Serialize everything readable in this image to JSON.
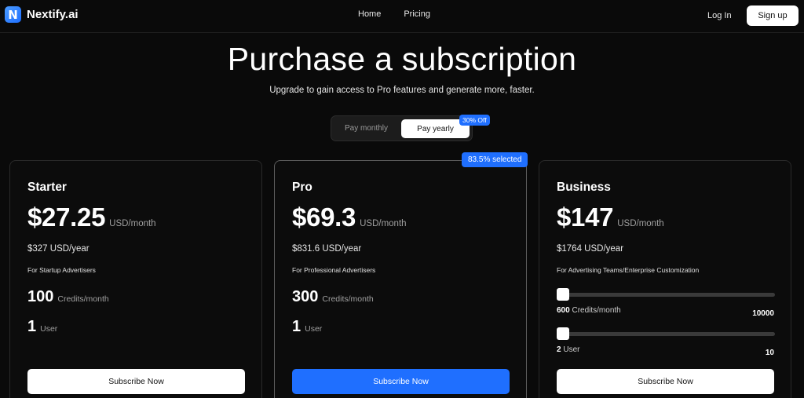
{
  "header": {
    "logo_letter": "N",
    "brand": "Nextify.ai",
    "nav": [
      "Home",
      "Pricing"
    ],
    "login": "Log In",
    "signup": "Sign up"
  },
  "hero": {
    "title": "Purchase a subscription",
    "subtitle": "Upgrade to gain access to Pro features and generate more, faster."
  },
  "billing_toggle": {
    "monthly": "Pay monthly",
    "yearly": "Pay yearly",
    "selected": "yearly",
    "discount_badge": "30% Off"
  },
  "plans": {
    "starter": {
      "name": "Starter",
      "price": "$27.25",
      "price_unit": "USD/month",
      "yearly": "$327 USD/year",
      "audience": "For Startup Advertisers",
      "credits": "100",
      "credits_unit": "Credits/month",
      "users": "1",
      "users_unit": "User",
      "cta": "Subscribe Now"
    },
    "pro": {
      "name": "Pro",
      "selected_badge": "83.5% selected",
      "price": "$69.3",
      "price_unit": "USD/month",
      "yearly": "$831.6 USD/year",
      "audience": "For Professional Advertisers",
      "credits": "300",
      "credits_unit": "Credits/month",
      "users": "1",
      "users_unit": "User",
      "cta": "Subscribe Now"
    },
    "business": {
      "name": "Business",
      "price": "$147",
      "price_unit": "USD/month",
      "yearly": "$1764 USD/year",
      "audience": "For Advertising Teams/Enterprise Customization",
      "credits_value": "600",
      "credits_unit": "Credits/month",
      "credits_max": "10000",
      "users_value": "2",
      "users_unit": "User",
      "users_max": "10",
      "cta": "Subscribe Now"
    }
  },
  "colors": {
    "background": "#0a0a0a",
    "accent": "#1f6fff"
  }
}
